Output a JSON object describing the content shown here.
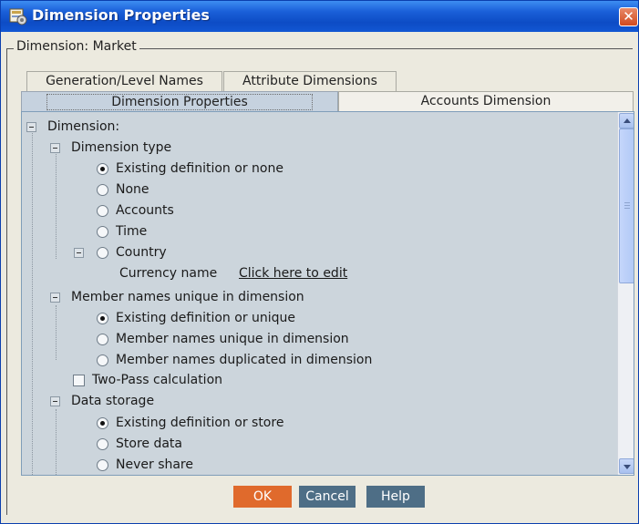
{
  "window": {
    "title": "Dimension Properties",
    "close_glyph": "✕"
  },
  "group": {
    "label": "Dimension: Market"
  },
  "tabs": [
    {
      "label": "Generation/Level Names",
      "selected": false
    },
    {
      "label": "Attribute Dimensions",
      "selected": false
    },
    {
      "label": "Dimension Properties",
      "selected": true
    },
    {
      "label": "Accounts Dimension",
      "selected": false
    }
  ],
  "tree": {
    "root_label": "Dimension:",
    "dimension_type": {
      "label": "Dimension type",
      "options": [
        {
          "label": "Existing definition or none",
          "checked": true
        },
        {
          "label": "None",
          "checked": false
        },
        {
          "label": "Accounts",
          "checked": false
        },
        {
          "label": "Time",
          "checked": false
        },
        {
          "label": "Country",
          "checked": false
        }
      ],
      "currency": {
        "label": "Currency name",
        "link": "Click here to edit"
      }
    },
    "member_names": {
      "label": "Member names unique in dimension",
      "options": [
        {
          "label": "Existing definition or unique",
          "checked": true
        },
        {
          "label": "Member names unique in dimension",
          "checked": false
        },
        {
          "label": "Member names duplicated in dimension",
          "checked": false
        }
      ]
    },
    "two_pass": {
      "label": "Two-Pass calculation",
      "checked": false
    },
    "data_storage": {
      "label": "Data storage",
      "options": [
        {
          "label": "Existing definition or store",
          "checked": true
        },
        {
          "label": "Store data",
          "checked": false
        },
        {
          "label": "Never share",
          "checked": false
        }
      ]
    }
  },
  "buttons": {
    "ok": "OK",
    "cancel": "Cancel",
    "help": "Help"
  },
  "colors": {
    "titlebar": "#1257d3",
    "panel_bg": "#ccd5dc",
    "ok_button": "#e06a2c",
    "secondary_button": "#4e6e86"
  }
}
